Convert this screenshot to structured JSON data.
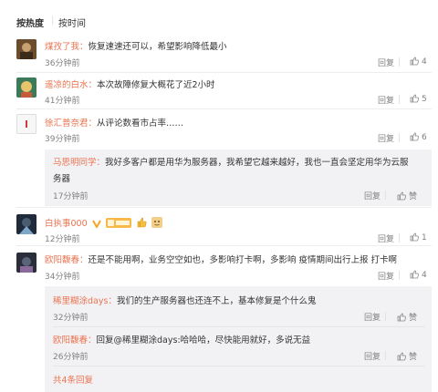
{
  "sort": {
    "hot": "按热度",
    "sep": "|",
    "time": "按时间"
  },
  "comments": [
    {
      "name": "煤孜了我：",
      "text": "恢复速速还可以，希望影响降低最小",
      "time": "36分钟前",
      "reply": "回复",
      "likes": "4"
    },
    {
      "name": "遥凉的白水：",
      "text": "本次故障修复大概花了近2小时",
      "time": "41分钟前",
      "reply": "回复",
      "likes": "5"
    },
    {
      "name": "徐汇普奈君：",
      "text": "从评论数看市占率……",
      "time": "39分钟前",
      "reply": "回复",
      "likes": "6",
      "replies": [
        {
          "name": "马思明同学：",
          "text1": "我好多客户都是用华为服务器，我希望它越来越好，我也一直会坚定用华为云服",
          "text2": "务器",
          "time": "17分钟前",
          "reply": "回复",
          "likes": "赞"
        }
      ]
    },
    {
      "name": "白执事000",
      "text": "",
      "time": "12分钟前",
      "reply": "回复",
      "likes": "1"
    },
    {
      "name": "欧阳馥春：",
      "text": "还是不能用啊，业务空空如也，多影响打卡啊，多影响  疫情期间出行上报  打卡啊",
      "time": "34分钟前",
      "reply": "回复",
      "likes": "4",
      "replies": [
        {
          "name": "稀里糊涂days：",
          "text1": "我们的生产服务器也还连不上，基本修复是个什么鬼",
          "time": "32分钟前",
          "reply": "回复",
          "likes": "赞"
        },
        {
          "name": "欧阳馥春：",
          "text1": "回复@稀里糊涂days:哈哈哈，尽快能用就好，多说无益",
          "time": "26分钟前",
          "reply": "回复",
          "likes": "赞"
        }
      ],
      "more": "共4条回复"
    }
  ]
}
